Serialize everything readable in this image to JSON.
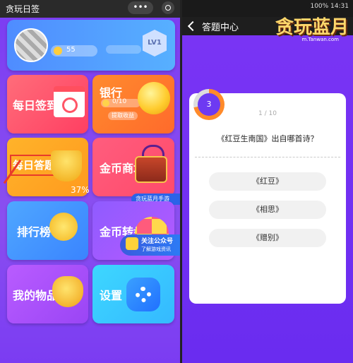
{
  "left": {
    "window_title": "贪玩日签",
    "menu_label": "•••",
    "profile": {
      "coins": "55",
      "level": "LV1"
    },
    "tiles": {
      "sign": "每日签到",
      "bank": "银行",
      "bank_value": "0/10",
      "bank_button": "提取收益",
      "quiz": "每日答题",
      "shop": "金币商城",
      "rank": "排行榜",
      "wheel": "金币转盘",
      "items": "我的物品",
      "settings": "设置"
    },
    "percent": "37%",
    "promo_tag": "贪玩蓝月手游",
    "follow_line1": "关注公众号",
    "follow_line2": "了解游戏资讯"
  },
  "right": {
    "status_text": "100% 14:31",
    "nav_title": "答题中心",
    "logo_text": "贪玩蓝月",
    "logo_url": "m.Tanwan.com",
    "progress_number": "3",
    "question_count": "1 / 10",
    "question": "《红豆生南国》出自哪首诗？",
    "options": [
      "《红豆》",
      "《相思》",
      "《赠别》"
    ]
  },
  "colors": {
    "background": "#7b3cf2",
    "highlight_red": "#e83b2b"
  }
}
